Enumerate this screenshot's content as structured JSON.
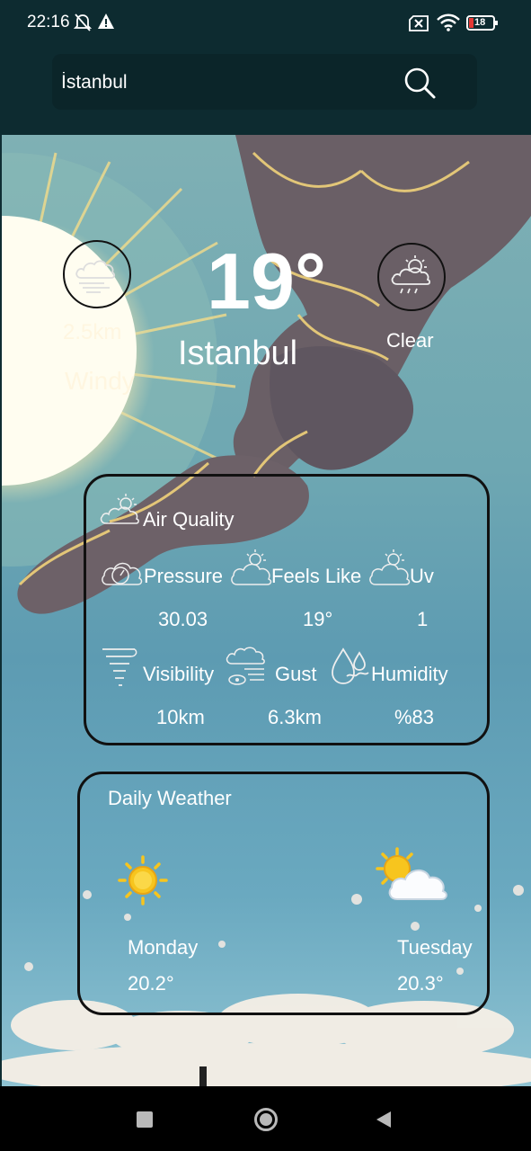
{
  "status_bar": {
    "time": "22:16",
    "battery": "18",
    "icons": [
      "bell-off-icon",
      "alert-triangle-icon",
      "sim-off-icon",
      "wifi-icon",
      "battery-icon"
    ]
  },
  "search": {
    "value": "İstanbul",
    "icon": "search-icon"
  },
  "current": {
    "temperature": "19°",
    "city": "Istanbul",
    "wind_speed": "2.5km",
    "wind_label": "Windy",
    "condition": "Clear",
    "wind_icon": "windy-cloud-icon",
    "condition_icon": "cloud-rain-sun-icon"
  },
  "air_quality": {
    "title": "Air Quality",
    "metrics": [
      {
        "label": "Pressure",
        "value": "30.03",
        "icon": "gauge-cloud-icon"
      },
      {
        "label": "Feels Like",
        "value": "19°",
        "icon": "cloud-sun-icon"
      },
      {
        "label": "Uv",
        "value": "1",
        "icon": "cloud-sun-icon"
      },
      {
        "label": "Visibility",
        "value": "10km",
        "icon": "tornado-icon"
      },
      {
        "label": "Gust",
        "value": "6.3km",
        "icon": "fog-eye-icon"
      },
      {
        "label": "Humidity",
        "value": "%83",
        "icon": "water-drops-icon"
      }
    ]
  },
  "daily": {
    "title": "Daily Weather",
    "days": [
      {
        "day": "Monday",
        "temp": "20.2°",
        "icon": "sun-icon"
      },
      {
        "day": "Tuesday",
        "temp": "20.3°",
        "icon": "partly-cloudy-icon"
      }
    ]
  },
  "nav": {
    "icons": [
      "recents-square-icon",
      "home-circle-icon",
      "back-triangle-icon"
    ]
  },
  "colors": {
    "header_bg": "#0d2b30",
    "search_bg": "#0b2529",
    "sun_yellow": "#f7c51e",
    "card_border": "#111111"
  }
}
